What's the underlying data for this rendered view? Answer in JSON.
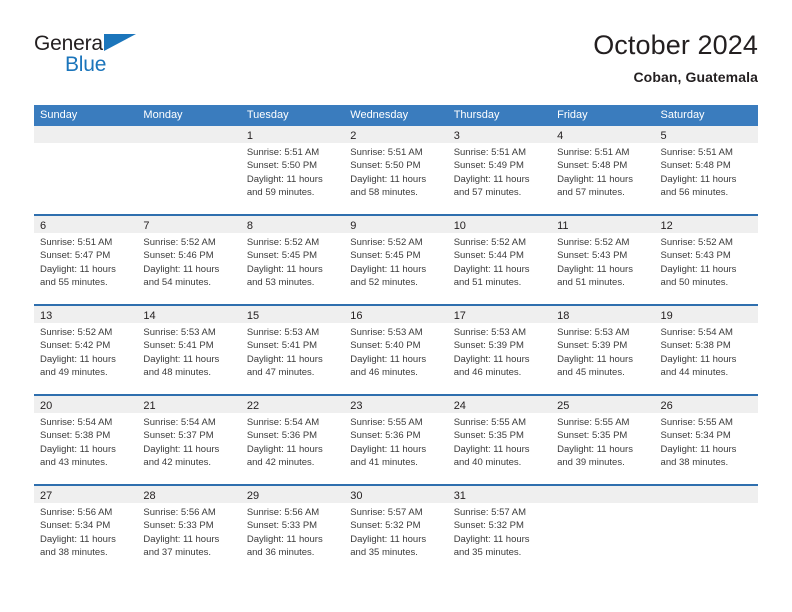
{
  "brand": {
    "name_top": "General",
    "name_bottom": "Blue",
    "triangle_icon": "brand-triangle-icon",
    "color_primary": "#1b75bb",
    "color_text": "#231f20"
  },
  "header": {
    "title": "October 2024",
    "subtitle": "Coban, Guatemala"
  },
  "calendar": {
    "header_bg": "#3a7cbe",
    "row_separator": "#2f6fae",
    "daynum_band_bg": "#efefef",
    "weekdays": [
      "Sunday",
      "Monday",
      "Tuesday",
      "Wednesday",
      "Thursday",
      "Friday",
      "Saturday"
    ],
    "weeks": [
      [
        {
          "day": "",
          "lines": []
        },
        {
          "day": "",
          "lines": []
        },
        {
          "day": "1",
          "lines": [
            "Sunrise: 5:51 AM",
            "Sunset: 5:50 PM",
            "Daylight: 11 hours",
            "and 59 minutes."
          ]
        },
        {
          "day": "2",
          "lines": [
            "Sunrise: 5:51 AM",
            "Sunset: 5:50 PM",
            "Daylight: 11 hours",
            "and 58 minutes."
          ]
        },
        {
          "day": "3",
          "lines": [
            "Sunrise: 5:51 AM",
            "Sunset: 5:49 PM",
            "Daylight: 11 hours",
            "and 57 minutes."
          ]
        },
        {
          "day": "4",
          "lines": [
            "Sunrise: 5:51 AM",
            "Sunset: 5:48 PM",
            "Daylight: 11 hours",
            "and 57 minutes."
          ]
        },
        {
          "day": "5",
          "lines": [
            "Sunrise: 5:51 AM",
            "Sunset: 5:48 PM",
            "Daylight: 11 hours",
            "and 56 minutes."
          ]
        }
      ],
      [
        {
          "day": "6",
          "lines": [
            "Sunrise: 5:51 AM",
            "Sunset: 5:47 PM",
            "Daylight: 11 hours",
            "and 55 minutes."
          ]
        },
        {
          "day": "7",
          "lines": [
            "Sunrise: 5:52 AM",
            "Sunset: 5:46 PM",
            "Daylight: 11 hours",
            "and 54 minutes."
          ]
        },
        {
          "day": "8",
          "lines": [
            "Sunrise: 5:52 AM",
            "Sunset: 5:45 PM",
            "Daylight: 11 hours",
            "and 53 minutes."
          ]
        },
        {
          "day": "9",
          "lines": [
            "Sunrise: 5:52 AM",
            "Sunset: 5:45 PM",
            "Daylight: 11 hours",
            "and 52 minutes."
          ]
        },
        {
          "day": "10",
          "lines": [
            "Sunrise: 5:52 AM",
            "Sunset: 5:44 PM",
            "Daylight: 11 hours",
            "and 51 minutes."
          ]
        },
        {
          "day": "11",
          "lines": [
            "Sunrise: 5:52 AM",
            "Sunset: 5:43 PM",
            "Daylight: 11 hours",
            "and 51 minutes."
          ]
        },
        {
          "day": "12",
          "lines": [
            "Sunrise: 5:52 AM",
            "Sunset: 5:43 PM",
            "Daylight: 11 hours",
            "and 50 minutes."
          ]
        }
      ],
      [
        {
          "day": "13",
          "lines": [
            "Sunrise: 5:52 AM",
            "Sunset: 5:42 PM",
            "Daylight: 11 hours",
            "and 49 minutes."
          ]
        },
        {
          "day": "14",
          "lines": [
            "Sunrise: 5:53 AM",
            "Sunset: 5:41 PM",
            "Daylight: 11 hours",
            "and 48 minutes."
          ]
        },
        {
          "day": "15",
          "lines": [
            "Sunrise: 5:53 AM",
            "Sunset: 5:41 PM",
            "Daylight: 11 hours",
            "and 47 minutes."
          ]
        },
        {
          "day": "16",
          "lines": [
            "Sunrise: 5:53 AM",
            "Sunset: 5:40 PM",
            "Daylight: 11 hours",
            "and 46 minutes."
          ]
        },
        {
          "day": "17",
          "lines": [
            "Sunrise: 5:53 AM",
            "Sunset: 5:39 PM",
            "Daylight: 11 hours",
            "and 46 minutes."
          ]
        },
        {
          "day": "18",
          "lines": [
            "Sunrise: 5:53 AM",
            "Sunset: 5:39 PM",
            "Daylight: 11 hours",
            "and 45 minutes."
          ]
        },
        {
          "day": "19",
          "lines": [
            "Sunrise: 5:54 AM",
            "Sunset: 5:38 PM",
            "Daylight: 11 hours",
            "and 44 minutes."
          ]
        }
      ],
      [
        {
          "day": "20",
          "lines": [
            "Sunrise: 5:54 AM",
            "Sunset: 5:38 PM",
            "Daylight: 11 hours",
            "and 43 minutes."
          ]
        },
        {
          "day": "21",
          "lines": [
            "Sunrise: 5:54 AM",
            "Sunset: 5:37 PM",
            "Daylight: 11 hours",
            "and 42 minutes."
          ]
        },
        {
          "day": "22",
          "lines": [
            "Sunrise: 5:54 AM",
            "Sunset: 5:36 PM",
            "Daylight: 11 hours",
            "and 42 minutes."
          ]
        },
        {
          "day": "23",
          "lines": [
            "Sunrise: 5:55 AM",
            "Sunset: 5:36 PM",
            "Daylight: 11 hours",
            "and 41 minutes."
          ]
        },
        {
          "day": "24",
          "lines": [
            "Sunrise: 5:55 AM",
            "Sunset: 5:35 PM",
            "Daylight: 11 hours",
            "and 40 minutes."
          ]
        },
        {
          "day": "25",
          "lines": [
            "Sunrise: 5:55 AM",
            "Sunset: 5:35 PM",
            "Daylight: 11 hours",
            "and 39 minutes."
          ]
        },
        {
          "day": "26",
          "lines": [
            "Sunrise: 5:55 AM",
            "Sunset: 5:34 PM",
            "Daylight: 11 hours",
            "and 38 minutes."
          ]
        }
      ],
      [
        {
          "day": "27",
          "lines": [
            "Sunrise: 5:56 AM",
            "Sunset: 5:34 PM",
            "Daylight: 11 hours",
            "and 38 minutes."
          ]
        },
        {
          "day": "28",
          "lines": [
            "Sunrise: 5:56 AM",
            "Sunset: 5:33 PM",
            "Daylight: 11 hours",
            "and 37 minutes."
          ]
        },
        {
          "day": "29",
          "lines": [
            "Sunrise: 5:56 AM",
            "Sunset: 5:33 PM",
            "Daylight: 11 hours",
            "and 36 minutes."
          ]
        },
        {
          "day": "30",
          "lines": [
            "Sunrise: 5:57 AM",
            "Sunset: 5:32 PM",
            "Daylight: 11 hours",
            "and 35 minutes."
          ]
        },
        {
          "day": "31",
          "lines": [
            "Sunrise: 5:57 AM",
            "Sunset: 5:32 PM",
            "Daylight: 11 hours",
            "and 35 minutes."
          ]
        },
        {
          "day": "",
          "lines": []
        },
        {
          "day": "",
          "lines": []
        }
      ]
    ]
  }
}
